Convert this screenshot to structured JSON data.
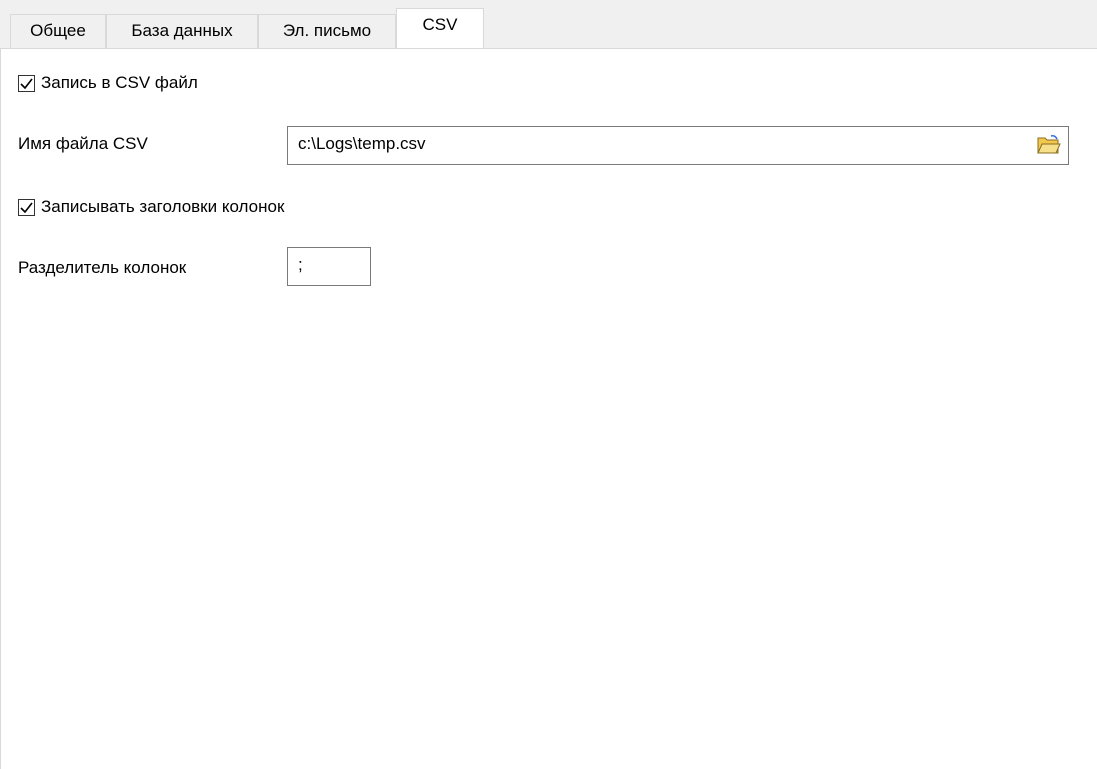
{
  "tabs": [
    {
      "label": "Общее"
    },
    {
      "label": "База данных"
    },
    {
      "label": "Эл. письмо"
    },
    {
      "label": "CSV"
    }
  ],
  "csv": {
    "write_csv_label": "Запись в CSV файл",
    "write_csv_checked": true,
    "filename_label": "Имя файла CSV",
    "filename_value": "c:\\Logs\\temp.csv",
    "write_headers_label": "Записывать заголовки колонок",
    "write_headers_checked": true,
    "separator_label": "Разделитель колонок",
    "separator_value": ";"
  },
  "icons": {
    "browse": "folder-open-icon",
    "check": "checkmark-icon"
  },
  "colors": {
    "tab_bg": "#f0f0f0",
    "border": "#d9d9d9",
    "folder": "#f2c94c"
  }
}
